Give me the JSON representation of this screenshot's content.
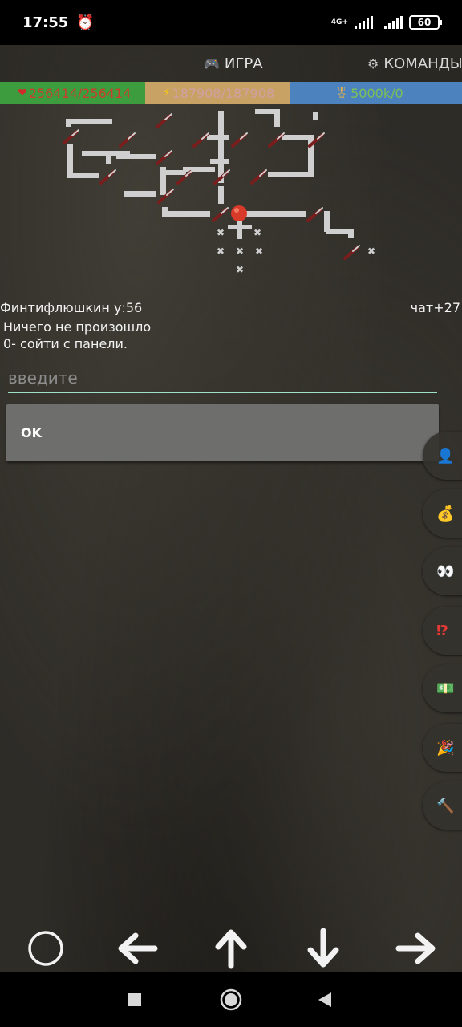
{
  "status_bar": {
    "time": "17:55",
    "network_label_top": "4G+",
    "battery": "60"
  },
  "tabs": {
    "game": {
      "icon": "gamepad-icon",
      "label": "ИГРА"
    },
    "commands": {
      "icon": "gear-icon",
      "label": "КОМАНДЫ"
    }
  },
  "stats": {
    "hp": {
      "icon": "heart-icon",
      "value": "256414/256414"
    },
    "energy": {
      "icon": "lightning-icon",
      "value": "187908/187908"
    },
    "medal": {
      "icon": "medal-icon",
      "value": "5000k/0"
    }
  },
  "info": {
    "player": "Финтифлюшкин  у:56",
    "chat": "чат+27",
    "message1": "Ничего не произошло",
    "message2": "0- сойти с панели."
  },
  "input": {
    "placeholder": "введите",
    "value": ""
  },
  "ok_button": {
    "label": "OK"
  },
  "side_buttons": [
    {
      "icon": "user-icon"
    },
    {
      "icon": "money-bag-icon"
    },
    {
      "icon": "eyes-icon"
    },
    {
      "icon": "exclamation-question-icon"
    },
    {
      "icon": "cash-icon"
    },
    {
      "icon": "party-popper-icon"
    },
    {
      "icon": "hammer-icon"
    }
  ],
  "controls": [
    {
      "icon": "circle-icon"
    },
    {
      "icon": "arrow-left-icon"
    },
    {
      "icon": "arrow-up-icon"
    },
    {
      "icon": "arrow-down-icon"
    },
    {
      "icon": "arrow-right-icon"
    }
  ],
  "nav": [
    {
      "icon": "recents-square-icon"
    },
    {
      "icon": "home-circle-icon"
    },
    {
      "icon": "back-triangle-icon"
    }
  ]
}
